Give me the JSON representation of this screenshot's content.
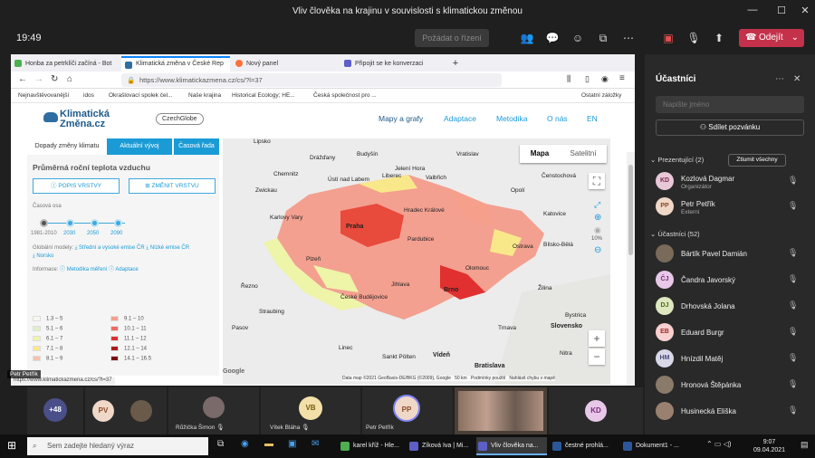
{
  "window": {
    "title": "Vliv člověka na krajinu v souvislosti s klimatickou změnou"
  },
  "meeting": {
    "time": "19:49",
    "request_control": "Požádat o řízení",
    "leave": "Odejít"
  },
  "browser": {
    "tabs": [
      {
        "label": "Honba za petrklíči začíná - Bot"
      },
      {
        "label": "Klimatická změna v České Rep"
      },
      {
        "label": "Nový panel"
      },
      {
        "label": "Připojit se ke konverzaci"
      }
    ],
    "url": "https://www.klimatickazmena.cz/cs/?l=37",
    "bookmarks": [
      "Nejnavštěvovanější",
      "idos",
      "Okrašlovací spolek čel...",
      "Naše krajina",
      "Historical Ecology; HE...",
      "Česká společnost pro ...",
      "Ostatní záložky"
    ],
    "status": "https://www.klimatickazmena.cz/cs/?l=37"
  },
  "site": {
    "logo": "Klimatická\nZměna.cz",
    "partner": "CzechGlobe",
    "menu": [
      "Mapy a grafy",
      "Adaptace",
      "Metodika",
      "O nás",
      "EN"
    ],
    "panel_tabs": [
      "Dopady změny klimatu",
      "Aktuální vývoj",
      "Časová řada"
    ],
    "title": "Průměrná roční teplota vzduchu",
    "btn_popis": "POPIS VRSTVY",
    "btn_zmenit": "ZMĚNIT VRSTVU",
    "axis_label": "Časová osa",
    "periods": [
      "1981-2010",
      "2030",
      "2050",
      "2090"
    ],
    "models_label": "Globální modely:",
    "model1": "Střední a vysoké emise ČR",
    "model2": "Nízké emise ČR",
    "model3": "Norsko",
    "info_label": "Informace:",
    "info1": "Metodika měření",
    "info2": "Adaptace",
    "legend": [
      {
        "label": "1.3 – 5",
        "color": "#f7f7f0"
      },
      {
        "label": "5.1 – 6",
        "color": "#e0f0c8"
      },
      {
        "label": "6.1 – 7",
        "color": "#eef4a8"
      },
      {
        "label": "7.1 – 8",
        "color": "#f9e88a"
      },
      {
        "label": "8.1 – 9",
        "color": "#f8c0b0"
      },
      {
        "label": "9.1 – 10",
        "color": "#f6a08c"
      },
      {
        "label": "10.1 – 11",
        "color": "#f06a5c"
      },
      {
        "label": "11.1 – 12",
        "color": "#e03030"
      },
      {
        "label": "12.1 – 14",
        "color": "#b01818"
      },
      {
        "label": "14.1 – 16.5",
        "color": "#7a1010"
      }
    ],
    "map": {
      "type_map": "Mapa",
      "type_sat": "Satelitní",
      "zoom_value": "10%",
      "attribution": "Data map ©2021 GeoBasis-DE/BKG (©2009), Google   50 km   Podmínky použití   Nahlásit chybu v mapě",
      "google": "Google",
      "cities": [
        "Lipsko",
        "Drážďany",
        "Budyšín",
        "Vratislav",
        "Chemnitz",
        "Liberec",
        "Jelení Hora",
        "Valbřich",
        "Ústí nad Labem",
        "Opolí",
        "Čenstochová",
        "Zwickau",
        "Karlovy Vary",
        "Praha",
        "Hradec Králové",
        "Katovice",
        "Pardubice",
        "Ostrava",
        "Bílsko-Bělá",
        "Plzeň",
        "Olomouc",
        "Řezno",
        "Jihlava",
        "Brno",
        "Žilina",
        "Straubing",
        "České Budějovice",
        "Trnava",
        "Bratislava",
        "Slovensko",
        "Linec",
        "Sankt Pölten",
        "Vídeň",
        "Pasov",
        "Nitra",
        "Bystrica"
      ]
    },
    "presenter_tag": "Petr Petřík"
  },
  "panel": {
    "title": "Účastníci",
    "search_placeholder": "Napište jméno",
    "share": "Sdílet pozvánku",
    "presenters_label": "Prezentující (2)",
    "mute_all": "Ztlumit všechny",
    "presenters": [
      {
        "initials": "KD",
        "name": "Kozlová Dagmar",
        "role": "Organizátor"
      },
      {
        "initials": "PP",
        "name": "Petr Petřík",
        "role": "Externí"
      }
    ],
    "participants_label": "Účastníci (52)",
    "participants": [
      {
        "initials": "",
        "name": "Bártík Pavel Damián"
      },
      {
        "initials": "ČJ",
        "name": "Čandra Javorský"
      },
      {
        "initials": "DJ",
        "name": "Drhovská Jolana"
      },
      {
        "initials": "EB",
        "name": "Eduard Burgr"
      },
      {
        "initials": "HM",
        "name": "Hnízdil Matěj"
      },
      {
        "initials": "",
        "name": "Hronová Štěpánka"
      },
      {
        "initials": "",
        "name": "Husinecká Eliška"
      }
    ]
  },
  "gallery": {
    "more": "+48",
    "tiles": [
      {
        "initials": "PV",
        "name": ""
      },
      {
        "initials": "",
        "name": "Růžička Šimon"
      },
      {
        "initials": "VB",
        "name": "Vítek Bláha"
      },
      {
        "initials": "PP",
        "name": "Petr Petřík"
      },
      {
        "initials": "KD",
        "name": ""
      }
    ]
  },
  "taskbar": {
    "search": "Sem zadejte hledaný výraz",
    "apps": [
      "karel kříž - Hle...",
      "Zíková Iva | Mi...",
      "Vliv člověka na...",
      "čestné prohlá...",
      "Dokument1 - ..."
    ],
    "time": "9:07",
    "date": "09.04.2021"
  }
}
